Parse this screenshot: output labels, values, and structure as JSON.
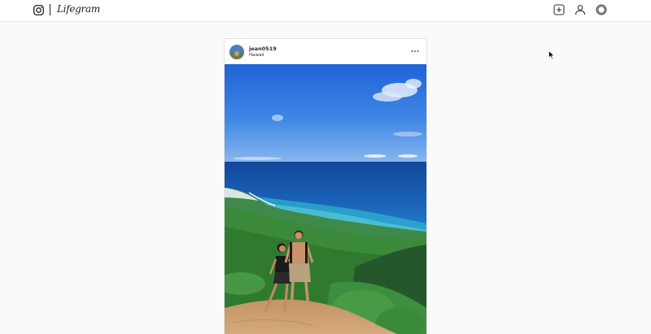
{
  "header": {
    "brand": "Lifegram",
    "icons": {
      "logo": "camera-icon",
      "new_post": "plus-square-icon",
      "profile": "user-icon",
      "explore": "compass-icon"
    }
  },
  "post": {
    "username": "jean0519",
    "location": "Hawaii",
    "more_icon": "ellipsis-icon",
    "photo_subject": "two hikers on a ridge overlooking ocean"
  },
  "colors": {
    "header_bg": "#ffffff",
    "page_bg": "#fafafa",
    "border": "#e3e3e3",
    "text": "#262626"
  }
}
